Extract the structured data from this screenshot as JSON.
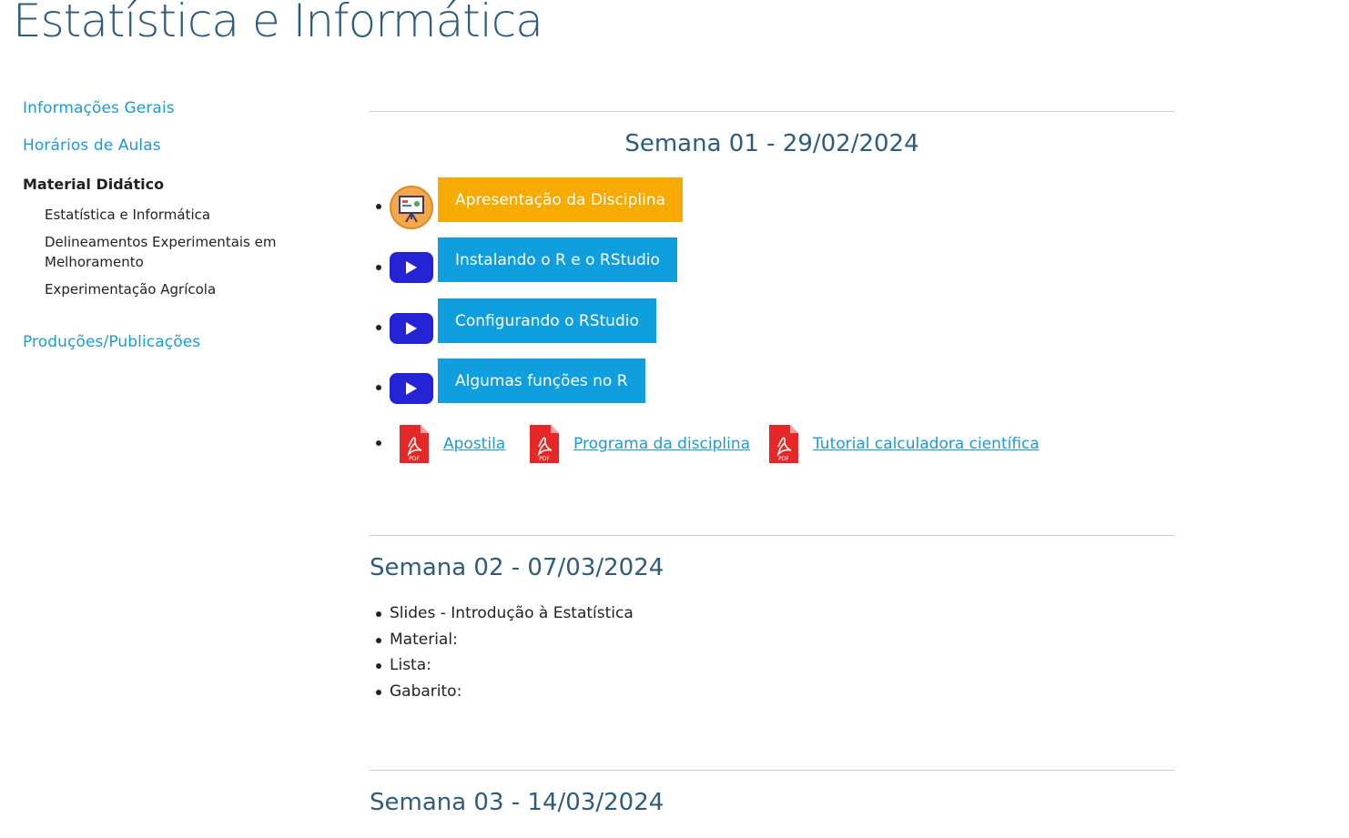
{
  "site": {
    "title": "Estatística e Informática"
  },
  "sidebar": {
    "links": [
      "Informações Gerais",
      "Horários de Aulas"
    ],
    "active_section": "Material Didático",
    "subitems": [
      "Estatística e Informática",
      "Delineamentos Experimentais em Melhoramento",
      "Experimentação Agrícola"
    ],
    "bottom_link": "Produções/Publicações"
  },
  "weeks": [
    {
      "title": "Semana 01 - 29/02/2024",
      "buttons": [
        {
          "label": "Apresentação da Disciplina",
          "icon": "presentation-icon",
          "color": "#f7aa00"
        },
        {
          "label": "Instalando o R e o RStudio",
          "icon": "youtube-play-icon",
          "color": "#0f9ede"
        },
        {
          "label": "Configurando o RStudio",
          "icon": "youtube-play-icon",
          "color": "#0f9ede"
        },
        {
          "label": "Algumas funções no R",
          "icon": "youtube-play-icon",
          "color": "#0f9ede"
        }
      ],
      "pdf_links": [
        "Apostila",
        "Programa da disciplina",
        "Tutorial calculadora científica"
      ]
    },
    {
      "title": "Semana 02 - 07/03/2024",
      "items": [
        "Slides - Introdução à Estatística",
        "Material:",
        "Lista:",
        "Gabarito:"
      ]
    },
    {
      "title": "Semana 03 - 14/03/2024"
    }
  ],
  "icons": {
    "pdf_label": "PDF"
  },
  "colors": {
    "title": "#2e5c7a",
    "link": "#1a9bd7",
    "orange": "#f7aa00",
    "blue": "#0f9ede",
    "youtube": "#2424d4",
    "pdf_red": "#e52727"
  }
}
